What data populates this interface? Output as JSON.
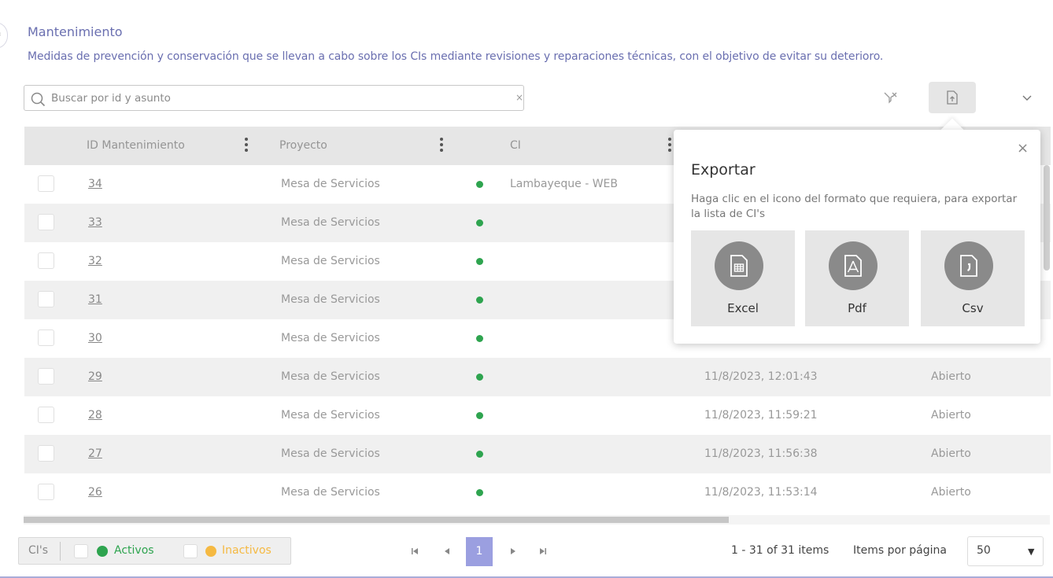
{
  "page": {
    "title": "Mantenimiento",
    "description": "Medidas de prevención y conservación que se llevan a cabo sobre los CIs mediante revisiones y reparaciones técnicas, con el objetivo de evitar su deterioro."
  },
  "search": {
    "placeholder": "Buscar por id y asunto",
    "value": "",
    "clear": "×"
  },
  "toolbar": {
    "filter_icon": "clear-filter-icon",
    "export_icon": "export-icon",
    "more_icon": "chevron-down-icon"
  },
  "grid": {
    "columns": [
      "ID Mantenimiento",
      "Proyecto",
      "CI"
    ],
    "rows": [
      {
        "id": "34",
        "project": "Mesa de Servicios",
        "ci": "Lambayeque - WEB",
        "date": "",
        "status": ""
      },
      {
        "id": "33",
        "project": "Mesa de Servicios",
        "ci": "",
        "date": "",
        "status": ""
      },
      {
        "id": "32",
        "project": "Mesa de Servicios",
        "ci": "",
        "date": "",
        "status": ""
      },
      {
        "id": "31",
        "project": "Mesa de Servicios",
        "ci": "",
        "date": "",
        "status": ""
      },
      {
        "id": "30",
        "project": "Mesa de Servicios",
        "ci": "",
        "date": "",
        "status": ""
      },
      {
        "id": "29",
        "project": "Mesa de Servicios",
        "ci": "",
        "date": "11/8/2023, 12:01:43",
        "status": "Abierto"
      },
      {
        "id": "28",
        "project": "Mesa de Servicios",
        "ci": "",
        "date": "11/8/2023, 11:59:21",
        "status": "Abierto"
      },
      {
        "id": "27",
        "project": "Mesa de Servicios",
        "ci": "",
        "date": "11/8/2023, 11:56:38",
        "status": "Abierto"
      },
      {
        "id": "26",
        "project": "Mesa de Servicios",
        "ci": "",
        "date": "11/8/2023, 11:53:14",
        "status": "Abierto"
      }
    ]
  },
  "legend": {
    "label": "CI's",
    "active": "Activos",
    "inactive": "Inactivos",
    "active_color": "#2ea44f",
    "inactive_color": "#f5b942"
  },
  "pager": {
    "current_page": "1",
    "first_icon": "first-page-icon",
    "prev_icon": "prev-page-icon",
    "next_icon": "next-page-icon",
    "last_icon": "last-page-icon",
    "items_info": "1 - 31 of 31 items",
    "per_page_label": "Items por página",
    "per_page_value": "50"
  },
  "export_popup": {
    "title": "Exportar",
    "description": "Haga clic en el icono del formato que requiera, para exportar la lista de CI's",
    "close": "×",
    "formats": [
      {
        "label": "Excel",
        "icon": "excel-file-icon"
      },
      {
        "label": "Pdf",
        "icon": "pdf-file-icon"
      },
      {
        "label": "Csv",
        "icon": "csv-file-icon"
      }
    ]
  },
  "colors": {
    "accent": "#6a6fb0",
    "pager_active": "#9b9fe0",
    "header_bg": "#e6e6e6"
  }
}
